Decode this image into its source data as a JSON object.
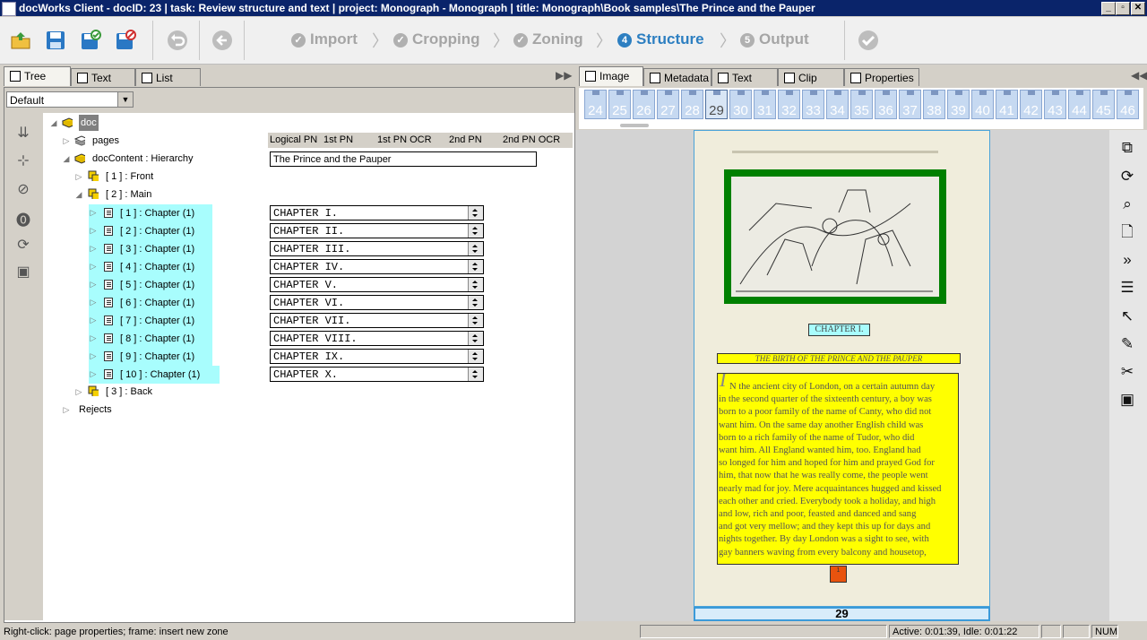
{
  "window": {
    "title": "docWorks Client - docID: 23 | task: Review structure and text | project: Monograph - Monograph | title: Monograph\\Book samples\\The Prince and the Pauper",
    "buttons": [
      "_",
      "▫",
      "✕"
    ]
  },
  "workflow": {
    "steps": [
      {
        "num": "",
        "label": "Import",
        "state": "done"
      },
      {
        "num": "",
        "label": "Cropping",
        "state": "done"
      },
      {
        "num": "",
        "label": "Zoning",
        "state": "done"
      },
      {
        "num": "4",
        "label": "Structure",
        "state": "active"
      },
      {
        "num": "5",
        "label": "Output",
        "state": "todo"
      }
    ]
  },
  "left_tabs": [
    "Tree",
    "Text",
    "List"
  ],
  "right_tabs": [
    "Image",
    "Metadata",
    "Text",
    "Clip",
    "Properties"
  ],
  "view_combo": "Default",
  "tree": {
    "root": "doc",
    "pages": "pages",
    "content": "docContent : Hierarchy",
    "front": "[ 1 ] : Front",
    "main": "[ 2 ] : Main",
    "chapters": [
      "[ 1 ] : Chapter (1)",
      "[ 2 ] : Chapter (1)",
      "[ 3 ] : Chapter (1)",
      "[ 4 ] : Chapter (1)",
      "[ 5 ] : Chapter (1)",
      "[ 6 ] : Chapter (1)",
      "[ 7 ] : Chapter (1)",
      "[ 8 ] : Chapter (1)",
      "[ 9 ] : Chapter (1)",
      "[ 10 ] : Chapter (1)"
    ],
    "back": "[ 3 ] : Back",
    "rejects": "Rejects"
  },
  "columns": [
    "Logical PN",
    "1st PN",
    "1st PN OCR",
    "2nd PN",
    "2nd PN OCR"
  ],
  "content_title": "The Prince and the Pauper",
  "chapter_titles": [
    "CHAPTER I.",
    "CHAPTER II.",
    "CHAPTER III.",
    "CHAPTER IV.",
    "CHAPTER V.",
    "CHAPTER VI.",
    "CHAPTER VII.",
    "CHAPTER VIII.",
    "CHAPTER IX.",
    "CHAPTER X."
  ],
  "thumbnails": [
    "24",
    "25",
    "26",
    "27",
    "28",
    "29",
    "30",
    "31",
    "32",
    "33",
    "34",
    "35",
    "36",
    "37",
    "38",
    "39",
    "40",
    "41",
    "42",
    "43",
    "44",
    "45",
    "46"
  ],
  "selected_page": "29",
  "page_image": {
    "chapter_heading": "CHAPTER I.",
    "subtitle": "THE BIRTH OF THE PRINCE AND THE PAUPER",
    "drop_cap": "I",
    "body_lines": [
      "N the ancient city of London, on a certain autumn day",
      "in the second quarter of the sixteenth century, a boy was",
      "born to a poor family of the name of Canty, who did not",
      "want him. On the same day another English child was",
      "born to a rich family of the name of Tudor, who did",
      "want him. All England wanted him, too. England had",
      "so longed for him and hoped for him and prayed God for",
      "him, that now that he was really come, the people went",
      "nearly mad for joy. Mere acquaintances hugged and kissed",
      "each other and cried. Everybody took a holiday, and high",
      "and low, rich and poor, feasted and danced and sang",
      "and got very mellow; and they kept this up for days and",
      "nights together. By day London was a sight to see, with",
      "gay banners waving from every balcony and housetop,"
    ],
    "folio": "1",
    "page_number": "29"
  },
  "status": {
    "hint": "Right-click: page properties; frame: insert new zone",
    "timer": "Active: 0:01:39, Idle: 0:01:22",
    "num": "NUM"
  },
  "colors": {
    "accent": "#2d7fc1",
    "highlight": "#a8fdfd",
    "zone_text": "#ffff00",
    "zone_image": "#008000",
    "zone_folio": "#e8530e"
  }
}
